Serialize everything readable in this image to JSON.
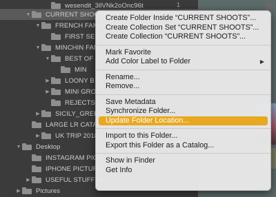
{
  "tree": [
    {
      "label": "wesendit_3llVNk2oOnc96t",
      "indent": 2,
      "tri": "",
      "count": "1",
      "selected": false
    },
    {
      "label": "CURRENT SHOOTS",
      "indent": 0,
      "tri": "down",
      "count": "",
      "selected": true
    },
    {
      "label": "FRENCH FAMI",
      "indent": 1,
      "tri": "down",
      "count": "",
      "selected": false
    },
    {
      "label": "FIRST SE",
      "indent": 2,
      "tri": "",
      "count": "",
      "selected": false
    },
    {
      "label": "MINCHIN FAM",
      "indent": 1,
      "tri": "down",
      "count": "",
      "selected": false
    },
    {
      "label": "BEST OF",
      "indent": 2,
      "tri": "down",
      "count": "",
      "selected": false
    },
    {
      "label": "MIN",
      "indent": 3,
      "tri": "",
      "count": "",
      "selected": false
    },
    {
      "label": "LOONY B",
      "indent": 2,
      "tri": "right",
      "count": "",
      "selected": false
    },
    {
      "label": "MINI GRO",
      "indent": 2,
      "tri": "right",
      "count": "",
      "selected": false
    },
    {
      "label": "REJECTS",
      "indent": 2,
      "tri": "",
      "count": "",
      "selected": false
    },
    {
      "label": "SICILY_GREEC",
      "indent": 1,
      "tri": "right",
      "count": "",
      "selected": false
    },
    {
      "label": "LARGE LR CATALO",
      "indent": 0,
      "tri": "",
      "count": "",
      "selected": false
    },
    {
      "label": "UK TRIP 2018",
      "indent": 1,
      "tri": "right",
      "count": "",
      "selected": false
    },
    {
      "label": "Desktop",
      "indent": -1,
      "tri": "down",
      "count": "",
      "selected": false
    },
    {
      "label": "INSTAGRAM PICS",
      "indent": 0,
      "tri": "",
      "count": "",
      "selected": false
    },
    {
      "label": "IPHONE PICTURES",
      "indent": 0,
      "tri": "",
      "count": "",
      "selected": false
    },
    {
      "label": "USEFUL STUFF QU",
      "indent": 0,
      "tri": "right",
      "count": "",
      "selected": false
    },
    {
      "label": "Pictures",
      "indent": -1,
      "tri": "right",
      "count": "",
      "selected": false
    }
  ],
  "menu": {
    "items": [
      {
        "label": "Create Folder Inside “CURRENT SHOOTS”...",
        "type": "item"
      },
      {
        "label": "Create Collection Set “CURRENT SHOOTS”...",
        "type": "item"
      },
      {
        "label": "Create Collection “CURRENT SHOOTS”...",
        "type": "item"
      },
      {
        "type": "sep"
      },
      {
        "label": "Mark Favorite",
        "type": "item"
      },
      {
        "label": "Add Color Label to Folder",
        "type": "item",
        "submenu": true
      },
      {
        "type": "sep"
      },
      {
        "label": "Rename...",
        "type": "item"
      },
      {
        "label": "Remove...",
        "type": "item"
      },
      {
        "type": "sep"
      },
      {
        "label": "Save Metadata",
        "type": "item"
      },
      {
        "label": "Synchronize Folder...",
        "type": "item"
      },
      {
        "label": "Update Folder Location...",
        "type": "item",
        "highlighted": true
      },
      {
        "type": "sep"
      },
      {
        "label": "Import to this Folder...",
        "type": "item"
      },
      {
        "label": "Export this Folder as a Catalog...",
        "type": "item"
      },
      {
        "type": "sep"
      },
      {
        "label": "Show in Finder",
        "type": "item"
      },
      {
        "label": "Get Info",
        "type": "item"
      }
    ],
    "submenu_arrow": "▶"
  },
  "colors": {
    "highlight": "#e8a820",
    "menu_bg": "#e8e8e8",
    "panel_bg": "#3b3b3b"
  },
  "icons": {
    "folder": "folder-icon",
    "disclosure": "disclosure-triangle-icon"
  }
}
